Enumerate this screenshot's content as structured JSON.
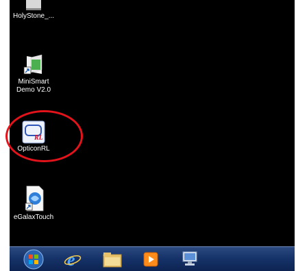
{
  "desktop": {
    "icons": [
      {
        "label": "HolyStone_..."
      },
      {
        "label": "MiniSmart",
        "label2": "Demo V2.0"
      },
      {
        "label": "OpticonRL"
      },
      {
        "label": "eGalaxTouch"
      }
    ],
    "highlighted_icon": "OpticonRL",
    "highlight_color": "#e3131b"
  },
  "taskbar": {
    "items": [
      {
        "icon": "start-orb-icon"
      },
      {
        "icon": "internet-explorer-icon"
      },
      {
        "icon": "file-explorer-icon"
      },
      {
        "icon": "media-player-icon"
      },
      {
        "icon": "network-computer-icon"
      }
    ]
  }
}
